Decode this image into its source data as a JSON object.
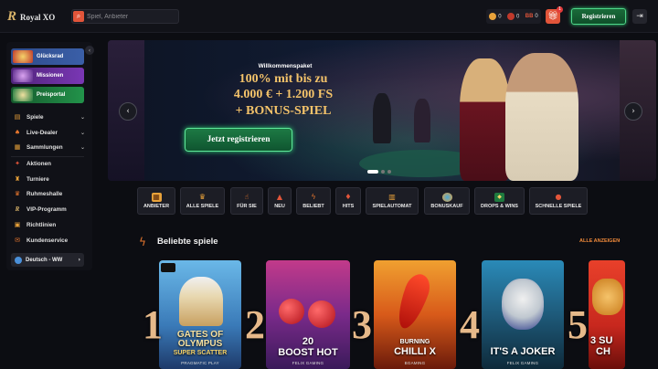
{
  "header": {
    "logo_mark": "R",
    "logo_text": "Royal XO",
    "search_placeholder": "Spiel, Anbieter",
    "coins_value": "0",
    "gems_value": "0",
    "bb_value": "0",
    "bb_label": "BB",
    "gift_badge": "1",
    "register_label": "Registrieren"
  },
  "sidebar": {
    "promos": [
      {
        "label": "Glücksrad",
        "color": "#3a5fa8"
      },
      {
        "label": "Missionen",
        "color": "#6b2fa0"
      },
      {
        "label": "Preisportal",
        "color": "#1e7a3e"
      }
    ],
    "items": [
      {
        "label": "Spiele",
        "icon": "cards-icon"
      },
      {
        "label": "Live-Dealer",
        "icon": "dealer-icon"
      },
      {
        "label": "Sammlungen",
        "icon": "collections-icon"
      },
      {
        "label": "Aktionen",
        "icon": "promotions-icon"
      },
      {
        "label": "Turniere",
        "icon": "tournament-icon"
      },
      {
        "label": "Ruhmeshalle",
        "icon": "hall-of-fame-icon"
      },
      {
        "label": "VIP-Programm",
        "icon": "vip-icon"
      },
      {
        "label": "Richtlinien",
        "icon": "policy-icon"
      },
      {
        "label": "Kundenservice",
        "icon": "support-icon"
      }
    ],
    "language": "Deutsch - WW"
  },
  "hero": {
    "kicker": "Willkommenspaket",
    "lines": [
      "100% mit bis zu",
      "4.000 € + 1.200 FS",
      "+ BONUS-SPIEL"
    ],
    "cta": "Jetzt registrieren",
    "slide_count": 3,
    "active_slide": 1
  },
  "categories": [
    {
      "label": "ANBIETER",
      "icon": "provider-icon"
    },
    {
      "label": "ALLE SPIELE",
      "icon": "crown-icon"
    },
    {
      "label": "FÜR SIE",
      "icon": "thumbs-up-icon"
    },
    {
      "label": "NEU",
      "icon": "new-icon"
    },
    {
      "label": "BELIEBT",
      "icon": "lightning-icon"
    },
    {
      "label": "HITS",
      "icon": "hits-icon"
    },
    {
      "label": "SPIELAUTOMAT",
      "icon": "slot-machine-icon"
    },
    {
      "label": "BONUSKAUF",
      "icon": "bonus-buy-icon"
    },
    {
      "label": "DROPS & WINS",
      "icon": "drops-wins-icon"
    },
    {
      "label": "SCHNELLE SPIELE",
      "icon": "fast-games-icon"
    }
  ],
  "popular": {
    "title": "Beliebte spiele",
    "see_all": "ALLE ANZEIGEN",
    "games": [
      {
        "rank": "1",
        "title_lines": [
          "GATES OF",
          "OLYMPUS"
        ],
        "sub": "SUPER SCATTER",
        "provider": "PRAGMATIC PLAY",
        "color": "#4a9fd8"
      },
      {
        "rank": "2",
        "title_lines": [
          "20",
          "BOOST HOT"
        ],
        "sub": "",
        "provider": "FELIX GAMING",
        "color": "#8a2a7a"
      },
      {
        "rank": "3",
        "title_lines": [
          "BURNING",
          "CHILLI X"
        ],
        "sub": "",
        "provider": "BGAMING",
        "color": "#d85a1a"
      },
      {
        "rank": "4",
        "title_lines": [
          "IT'S A JOKER"
        ],
        "sub": "",
        "provider": "FELIX GAMING",
        "color": "#1e6a8a"
      },
      {
        "rank": "5",
        "title_lines": [
          "3 SU",
          "CH"
        ],
        "sub": "",
        "provider": "",
        "color": "#c8281e"
      }
    ]
  }
}
